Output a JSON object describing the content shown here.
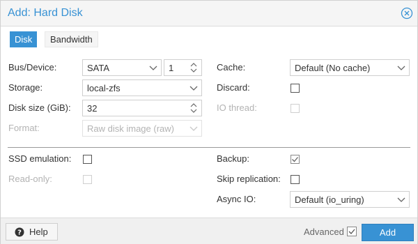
{
  "window": {
    "title": "Add: Hard Disk"
  },
  "tabs": [
    {
      "label": "Disk",
      "active": true
    },
    {
      "label": "Bandwidth",
      "active": false
    }
  ],
  "left": {
    "bus_device": {
      "label": "Bus/Device:",
      "bus_value": "SATA",
      "device_value": "1"
    },
    "storage": {
      "label": "Storage:",
      "value": "local-zfs"
    },
    "disk_size": {
      "label": "Disk size (GiB):",
      "value": "32"
    },
    "format": {
      "label": "Format:",
      "value": "Raw disk image (raw)",
      "disabled": true
    },
    "ssd_emulation": {
      "label": "SSD emulation:",
      "checked": false
    },
    "read_only": {
      "label": "Read-only:",
      "checked": false,
      "disabled": true
    }
  },
  "right": {
    "cache": {
      "label": "Cache:",
      "value": "Default (No cache)"
    },
    "discard": {
      "label": "Discard:",
      "checked": false
    },
    "io_thread": {
      "label": "IO thread:",
      "checked": false,
      "disabled": true
    },
    "backup": {
      "label": "Backup:",
      "checked": true
    },
    "skip_replication": {
      "label": "Skip replication:",
      "checked": false
    },
    "async_io": {
      "label": "Async IO:",
      "value": "Default (io_uring)"
    }
  },
  "footer": {
    "help_label": "Help",
    "advanced_label": "Advanced",
    "advanced_checked": true,
    "add_label": "Add"
  },
  "colors": {
    "accent": "#3892d4",
    "disabled_text": "#b3b3b3"
  },
  "icons": {
    "close": "close-circle-icon",
    "help": "question-circle-icon",
    "dropdown": "chevron-down-icon",
    "spinner": "spinner-arrows-icon",
    "checkmark": "checkmark-icon"
  }
}
